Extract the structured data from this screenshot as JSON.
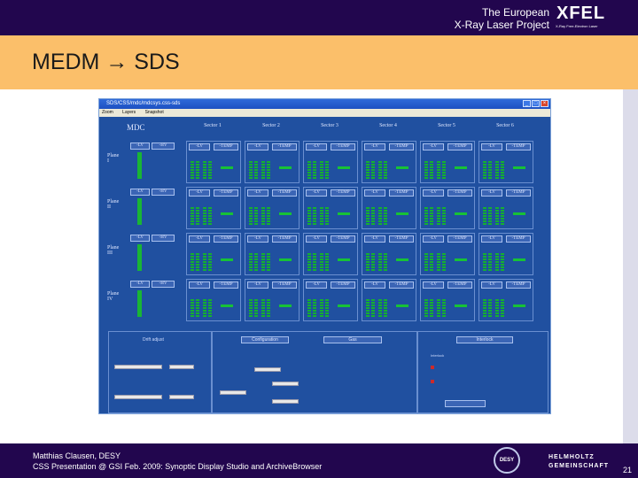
{
  "header": {
    "org_line1": "The European",
    "org_line2": "X-Ray Laser Project",
    "logo": "XFEL",
    "logo_sub": "X-Ray Free-Electron Laser"
  },
  "slide": {
    "title": "MEDM → SDS",
    "page_number": "21"
  },
  "footer": {
    "author": "Matthias Clausen, DESY",
    "event": "CSS Presentation @ GSI Feb. 2009: Synoptic Display Studio and ArchiveBrowser",
    "desy_logo": "DESY",
    "helmholtz_line1": "HELMHOLTZ",
    "helmholtz_line2": "GEMEINSCHAFT"
  },
  "window": {
    "title": "SDS/CSS/mdc/mdcsys.css-sds",
    "menu": [
      "Zoom",
      "Layers",
      "Snapshot"
    ],
    "mdc_label": "MDC",
    "sectors": [
      "Sector 1",
      "Sector 2",
      "Sector 3",
      "Sector 4",
      "Sector 5",
      "Sector 6"
    ],
    "planes": [
      {
        "label": "Plane",
        "num": "I"
      },
      {
        "label": "Plane",
        "num": "II"
      },
      {
        "label": "Plane",
        "num": "III"
      },
      {
        "label": "Plane",
        "num": "IV"
      }
    ],
    "cell_lv": "-LV",
    "cell_hv": "-HV",
    "cell_temp": "-TEMP",
    "bottom": {
      "left_title": "Drift adjust",
      "mid_btn1": "Configuration",
      "mid_btn2": "Gas",
      "right_btn1": "Interlock",
      "right_txt": "Interlock"
    }
  }
}
